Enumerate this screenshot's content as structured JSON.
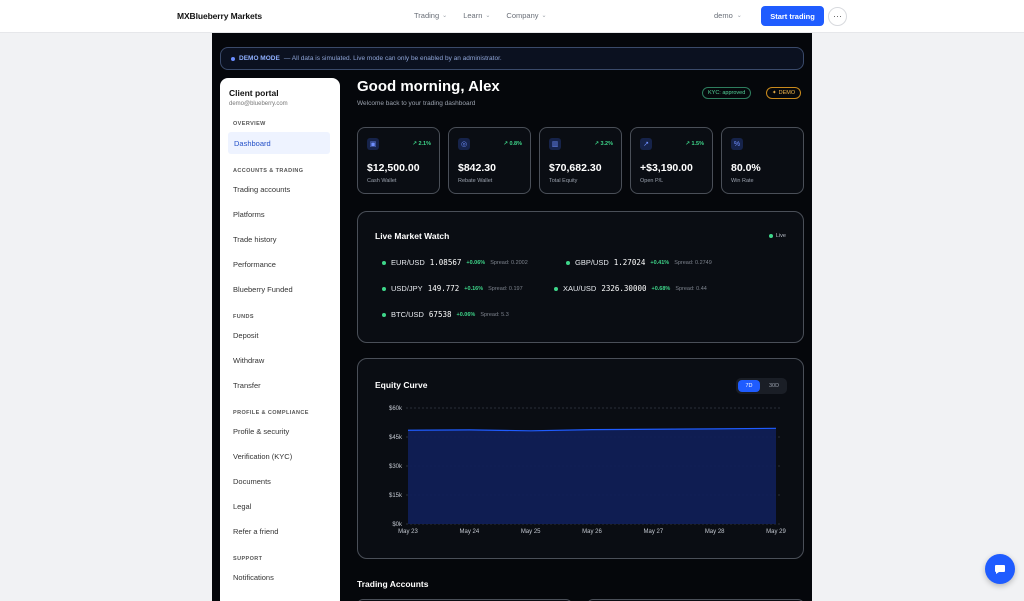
{
  "topnav": {
    "brand": "MXBlueberry Markets",
    "links": [
      "Trading",
      "Learn",
      "Company"
    ],
    "account": "demo",
    "start_trading": "Start trading",
    "more": "···"
  },
  "banner": {
    "label": "DEMO MODE",
    "text": "— All data is simulated. Live mode can only be enabled by an administrator."
  },
  "sidebar": {
    "title": "Client portal",
    "email": "demo@blueberry.com",
    "sections": {
      "overview": "OVERVIEW",
      "accounts": "ACCOUNTS & TRADING",
      "funds": "FUNDS",
      "profile": "PROFILE & COMPLIANCE",
      "support": "SUPPORT"
    },
    "items": {
      "dashboard": "Dashboard",
      "trading_accounts": "Trading accounts",
      "platforms": "Platforms",
      "trade_history": "Trade history",
      "performance": "Performance",
      "funded": "Blueberry Funded",
      "deposit": "Deposit",
      "withdraw": "Withdraw",
      "transfer": "Transfer",
      "profile_security": "Profile & security",
      "verification": "Verification (KYC)",
      "documents": "Documents",
      "legal": "Legal",
      "refer": "Refer a friend",
      "notifications": "Notifications"
    }
  },
  "header": {
    "greeting": "Good morning, Alex",
    "subtitle": "Welcome back to your trading dashboard",
    "kyc_badge": "KYC: approved",
    "demo_badge": "DEMO"
  },
  "stats": [
    {
      "icon": "wallet-icon",
      "glyph": "▣",
      "change": "↗ 2.1%",
      "value": "$12,500.00",
      "label": "Cash Wallet"
    },
    {
      "icon": "award-icon",
      "glyph": "◎",
      "change": "↗ 0.8%",
      "value": "$842.30",
      "label": "Rebate Wallet"
    },
    {
      "icon": "bar-chart-icon",
      "glyph": "▥",
      "change": "↗ 3.2%",
      "value": "$70,682.30",
      "label": "Total Equity"
    },
    {
      "icon": "trend-icon",
      "glyph": "↗",
      "change": "↗ 1.5%",
      "value": "+$3,190.00",
      "label": "Open P/L"
    },
    {
      "icon": "percent-icon",
      "glyph": "%",
      "change": "",
      "value": "80.0%",
      "label": "Win Rate"
    }
  ],
  "market": {
    "title": "Live Market Watch",
    "live": "Live",
    "quotes": [
      {
        "symbol": "EUR/USD",
        "price": "1.08567",
        "change": "+0.06%",
        "spread": "Spread: 0.2002"
      },
      {
        "symbol": "GBP/USD",
        "price": "1.27024",
        "change": "+0.41%",
        "spread": "Spread: 0.2749"
      },
      {
        "symbol": "USD/JPY",
        "price": "149.772",
        "change": "+0.16%",
        "spread": "Spread: 0.197"
      },
      {
        "symbol": "XAU/USD",
        "price": "2326.30000",
        "change": "+0.68%",
        "spread": "Spread: 0.44"
      },
      {
        "symbol": "BTC/USD",
        "price": "67538",
        "change": "+0.06%",
        "spread": "Spread: 5.3"
      }
    ]
  },
  "equity": {
    "title": "Equity Curve",
    "range_7d": "7D",
    "range_30d": "30D"
  },
  "chart_data": {
    "type": "area",
    "title": "Equity Curve",
    "x": [
      "May 23",
      "May 24",
      "May 25",
      "May 26",
      "May 27",
      "May 28",
      "May 29"
    ],
    "y_ticks": [
      "$60k",
      "$45k",
      "$30k",
      "$15k",
      "$0k"
    ],
    "ylim": [
      0,
      60000
    ],
    "series": [
      {
        "values": [
          48500,
          48700,
          48200,
          48800,
          49000,
          49200,
          49500
        ]
      }
    ],
    "grid": true,
    "color": "#1f5cff"
  },
  "accounts": {
    "title": "Trading Accounts"
  }
}
